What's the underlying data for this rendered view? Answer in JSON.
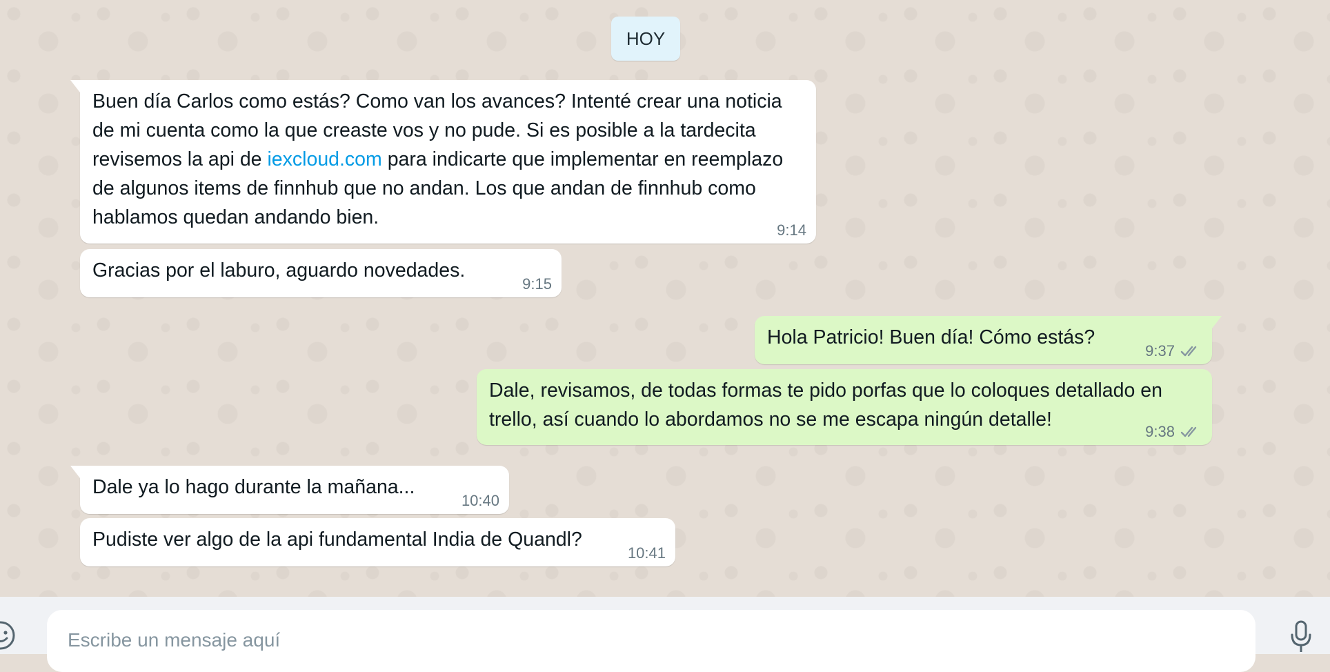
{
  "chat": {
    "date_label": "HOY",
    "messages": [
      {
        "direction": "incoming",
        "text_before": "Buen día Carlos como estás? Como van los avances? Intenté crear una noticia de mi cuenta como la que creaste vos y no pude. Si es posible a la tardecita revisemos la api de ",
        "link": "iexcloud.com",
        "text_after": " para indicarte que implementar en reemplazo de algunos items de finnhub que no andan. Los que andan de finnhub como hablamos quedan andando bien.",
        "time": "9:14"
      },
      {
        "direction": "incoming",
        "text": "Gracias por el laburo, aguardo novedades.",
        "time": "9:15"
      },
      {
        "direction": "outgoing",
        "text": "Hola Patricio! Buen día! Cómo estás?",
        "time": "9:37",
        "status": "read"
      },
      {
        "direction": "outgoing",
        "text": "Dale, revisamos, de todas formas te pido porfas que lo coloques detallado en trello, así cuando lo abordamos no se me escapa ningún detalle!",
        "time": "9:38",
        "status": "read"
      },
      {
        "direction": "incoming",
        "text": "Dale ya lo hago durante la mañana...",
        "time": "10:40"
      },
      {
        "direction": "incoming",
        "text": "Pudiste ver algo de la api fundamental India de Quandl?",
        "time": "10:41"
      }
    ]
  },
  "composer": {
    "placeholder": "Escribe un mensaje aquí",
    "value": ""
  },
  "icons": {
    "emoji": "emoji-icon",
    "mic": "microphone-icon",
    "read_status": "double-check-icon"
  },
  "colors": {
    "incoming_bubble": "#ffffff",
    "outgoing_bubble": "#dcf8c6",
    "wallpaper": "#e5ddd5",
    "link": "#039be5",
    "date_chip": "#e1f3fb"
  }
}
